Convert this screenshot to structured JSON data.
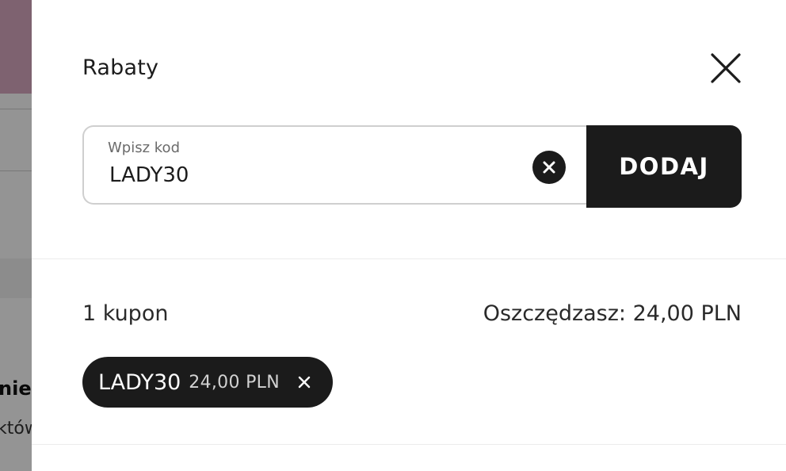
{
  "background": {
    "partial_text_1": "nie",
    "partial_text_2": "któw"
  },
  "modal": {
    "title": "Rabaty",
    "code_field": {
      "label": "Wpisz kod",
      "value": "LADY30"
    },
    "add_button_label": "DODAJ",
    "coupon_count": "1 kupon",
    "savings_label": "Oszczędzasz: 24,00 PLN",
    "applied_coupon": {
      "code": "LADY30",
      "amount": "24,00 PLN"
    }
  },
  "colors": {
    "primary_dark": "#1b1b1b",
    "border": "#cfcfcf",
    "background_banner": "#d9a9c2"
  },
  "icons": {
    "close": "close-icon",
    "clear": "clear-circle-icon",
    "remove": "remove-icon"
  }
}
